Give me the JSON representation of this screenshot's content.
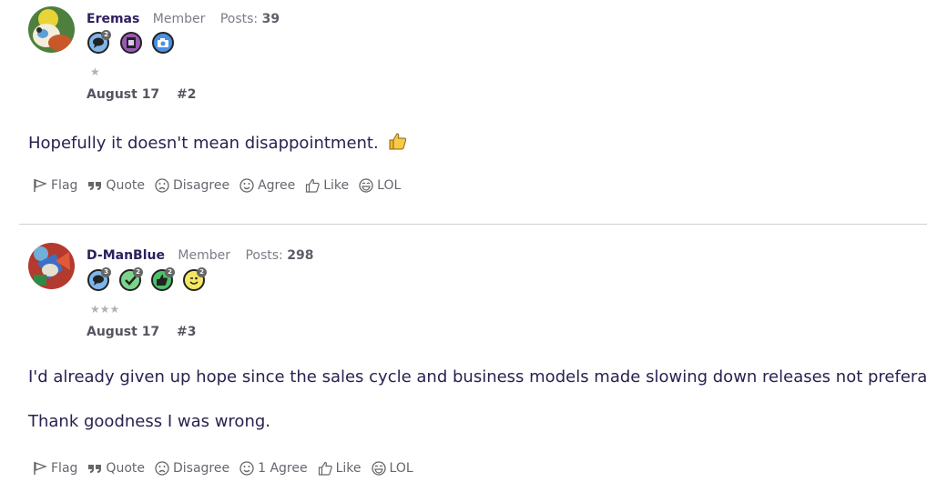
{
  "posts": [
    {
      "author": "Eremas",
      "role": "Member",
      "posts_label": "Posts:",
      "posts_count": "39",
      "badges": [
        {
          "icon": "speech-bubble-icon",
          "count": "2",
          "color": "#7fb6ea"
        },
        {
          "icon": "photo-album-icon",
          "count": "",
          "color": "#9b59b6"
        },
        {
          "icon": "camera-icon",
          "count": "",
          "color": "#4a90e2"
        }
      ],
      "stars": "★",
      "date": "August 17",
      "number": "#2",
      "content": [
        "Hopefully it doesn't mean disappointment."
      ],
      "content_emoji": "thumbs-up-emoji",
      "actions": {
        "flag": "Flag",
        "quote": "Quote",
        "disagree": "Disagree",
        "agree": "Agree",
        "like": "Like",
        "lol": "LOL"
      }
    },
    {
      "author": "D-ManBlue",
      "role": "Member",
      "posts_label": "Posts:",
      "posts_count": "298",
      "badges": [
        {
          "icon": "speech-bubble-icon",
          "count": "3",
          "color": "#7fb6ea"
        },
        {
          "icon": "checkmark-icon",
          "count": "2",
          "color": "#7ed38a"
        },
        {
          "icon": "thumbs-up-icon",
          "count": "2",
          "color": "#4fbf6a"
        },
        {
          "icon": "wink-face-icon",
          "count": "2",
          "color": "#f5e663"
        }
      ],
      "stars": "★★★",
      "date": "August 17",
      "number": "#3",
      "content": [
        "I'd already given up hope since the sales cycle and business models made slowing down releases not preferable.",
        "Thank goodness I was wrong."
      ],
      "actions": {
        "flag": "Flag",
        "quote": "Quote",
        "disagree": "Disagree",
        "agree": "1 Agree",
        "like": "Like",
        "lol": "LOL"
      }
    }
  ]
}
